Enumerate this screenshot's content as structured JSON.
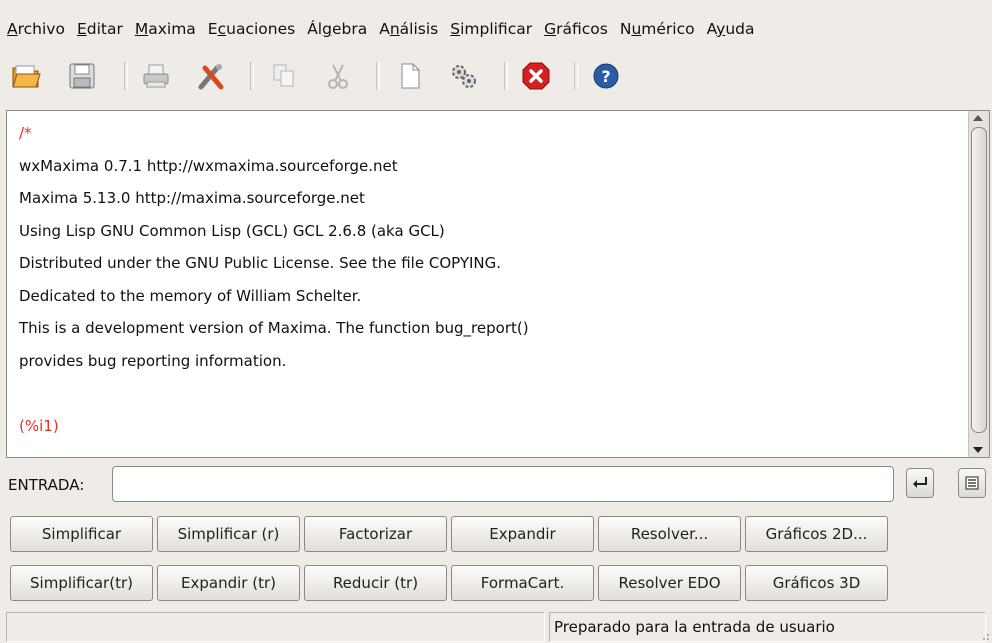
{
  "menu": [
    {
      "label": "Archivo",
      "mnemonic": "A",
      "rest": "rchivo"
    },
    {
      "label": "Editar",
      "mnemonic": "E",
      "rest": "ditar"
    },
    {
      "label": "Maxima",
      "mnemonic": "M",
      "rest": "axima"
    },
    {
      "label": "Ecuaciones",
      "prefix": "E",
      "mnemonic": "c",
      "rest": "uaciones"
    },
    {
      "label": "Álgebra",
      "prefix": "Ál",
      "mnemonic": "g",
      "rest": "ebra"
    },
    {
      "label": "Análisis",
      "prefix": "A",
      "mnemonic": "n",
      "rest": "álisis"
    },
    {
      "label": "Simplificar",
      "mnemonic": "S",
      "rest": "implificar"
    },
    {
      "label": "Gráficos",
      "mnemonic": "G",
      "rest": "ráficos"
    },
    {
      "label": "Numérico",
      "prefix": "N",
      "mnemonic": "u",
      "rest": "mérico"
    },
    {
      "label": "Ayuda",
      "prefix": "A",
      "mnemonic": "y",
      "rest": "uda"
    }
  ],
  "toolbar": {
    "icons": [
      "open-folder-icon",
      "save-disk-icon",
      "print-icon",
      "configure-tools-icon",
      "copy-icon",
      "cut-scissors-icon",
      "new-document-icon",
      "settings-gears-icon",
      "stop-error-icon",
      "help-icon"
    ]
  },
  "console": {
    "lines": [
      {
        "text": "/*",
        "color": "red"
      },
      {
        "text": "wxMaxima 0.7.1 http://wxmaxima.sourceforge.net",
        "color": "black"
      },
      {
        "text": "Maxima 5.13.0 http://maxima.sourceforge.net",
        "color": "black"
      },
      {
        "text": "Using Lisp GNU Common Lisp (GCL) GCL 2.6.8 (aka GCL)",
        "color": "black"
      },
      {
        "text": "Distributed under the GNU Public License. See the file COPYING.",
        "color": "black"
      },
      {
        "text": "Dedicated to the memory of William Schelter.",
        "color": "black"
      },
      {
        "text": "This is a development version of Maxima. The function bug_report()",
        "color": "black"
      },
      {
        "text": "provides bug reporting information.",
        "color": "black"
      },
      {
        "text": "",
        "color": "black"
      },
      {
        "text": "(%i1)",
        "color": "red"
      }
    ]
  },
  "input": {
    "label": "ENTRADA:",
    "value": ""
  },
  "buttons": {
    "row1": [
      "Simplificar",
      "Simplificar (r)",
      "Factorizar",
      "Expandir",
      "Resolver...",
      "Gráficos 2D..."
    ],
    "row2": [
      "Simplificar(tr)",
      "Expandir (tr)",
      "Reducir (tr)",
      "FormaCart.",
      "Resolver EDO",
      "Gráficos 3D"
    ]
  },
  "status": {
    "left": "",
    "right": "Preparado para la entrada de usuario"
  },
  "colors": {
    "background": "#efebe7",
    "prompt": "#e83030",
    "stop": "#d42020",
    "help": "#2a5ca8"
  }
}
